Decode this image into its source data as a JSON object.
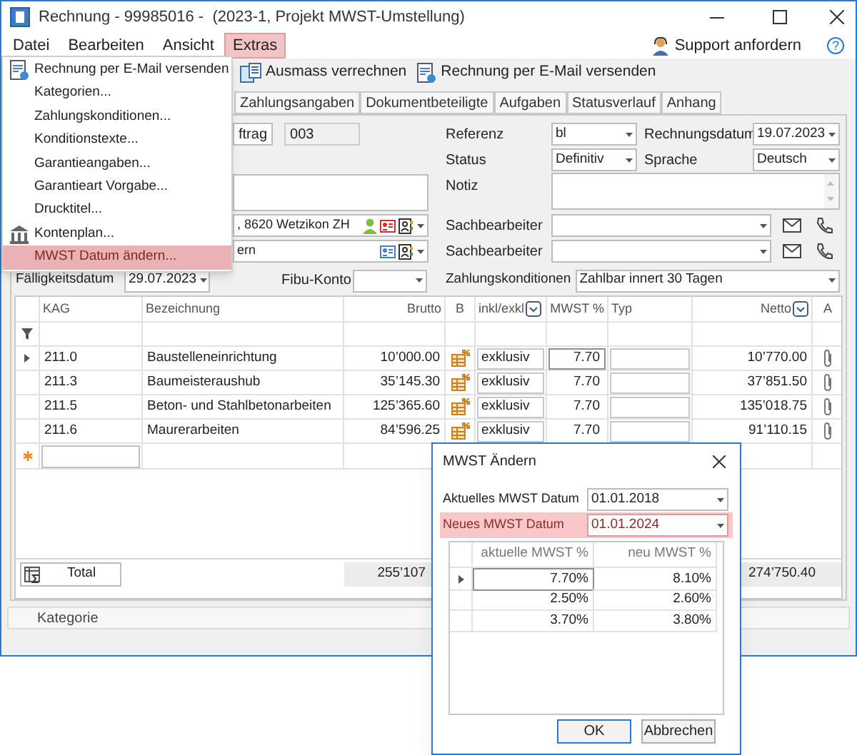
{
  "window": {
    "title": "Rechnung - 99985016 -  (2023-1, Projekt MWST-Umstellung)"
  },
  "menu_bar": {
    "items": [
      {
        "label": "Datei",
        "selected": false
      },
      {
        "label": "Bearbeiten",
        "selected": false
      },
      {
        "label": "Ansicht",
        "selected": false
      },
      {
        "label": "Extras",
        "selected": true
      }
    ],
    "support": "Support anfordern",
    "help": "?"
  },
  "extras_menu": {
    "items": [
      {
        "label": "Rechnung per E-Mail versenden",
        "kind": "email",
        "selected": false
      },
      {
        "label": "Kategorien...",
        "kind": "plain",
        "selected": false
      },
      {
        "label": "Zahlungskonditionen...",
        "kind": "plain",
        "selected": false
      },
      {
        "label": "Konditionstexte...",
        "kind": "plain",
        "selected": false
      },
      {
        "label": "Garantieangaben...",
        "kind": "plain",
        "selected": false
      },
      {
        "label": "Garantieart Vorgabe...",
        "kind": "plain",
        "selected": false
      },
      {
        "label": "Drucktitel...",
        "kind": "plain",
        "selected": false
      },
      {
        "label": "Kontenplan...",
        "kind": "bank",
        "selected": false
      },
      {
        "label": "MWST Datum ändern...",
        "kind": "plain",
        "selected": true
      }
    ]
  },
  "toolbar": [
    {
      "label": "Ausmass verrechnen",
      "kind": "measure"
    },
    {
      "label": "Rechnung per E-Mail versenden",
      "kind": "email"
    }
  ],
  "tabs": [
    {
      "label": "Zahlungsangaben",
      "selected": false
    },
    {
      "label": "Dokumentbeteiligte",
      "selected": false
    },
    {
      "label": "Aufgaben",
      "selected": false
    },
    {
      "label": "Statusverlauf",
      "selected": false
    },
    {
      "label": "Anhang",
      "selected": false
    }
  ],
  "form_left": {
    "order_button": "ftrag",
    "order_number": "003",
    "address": ", 8620 Wetzikon ZH",
    "contact": "ern",
    "due_label": "Fälligkeitsdatum",
    "due_value": "29.07.2023",
    "account_label": "Fibu-Konto"
  },
  "form_right": {
    "reference_label": "Referenz",
    "reference": "bl",
    "invoice_date_label": "Rechnungsdatum",
    "invoice_date": "19.07.2023",
    "status_label": "Status",
    "status": "Definitiv",
    "language_label": "Sprache",
    "language": "Deutsch",
    "note_label": "Notiz",
    "clerks": [
      {
        "label": "Sachbearbeiter"
      },
      {
        "label": "Sachbearbeiter"
      }
    ],
    "terms_label": "Zahlungskonditionen",
    "terms": "Zahlbar innert 30 Tagen"
  },
  "grid": {
    "columns": [
      {
        "label": "KAG",
        "dropdown": false
      },
      {
        "label": "Bezeichnung",
        "dropdown": false
      },
      {
        "label": "Brutto",
        "dropdown": false
      },
      {
        "label": "B",
        "dropdown": false
      },
      {
        "label": "inkl/exkl",
        "dropdown": true
      },
      {
        "label": "MWST %",
        "dropdown": false
      },
      {
        "label": "Typ",
        "dropdown": false
      },
      {
        "label": "Netto",
        "dropdown": true
      },
      {
        "label": "A",
        "dropdown": false
      }
    ],
    "rows": [
      {
        "kag": "211.0",
        "bezeichnung": "Baustelleneinrichtung",
        "brutto": "10’000.00",
        "inkl_exkl": "exklusiv",
        "mwst": "7.70",
        "netto": "10’770.00",
        "selected": true
      },
      {
        "kag": "211.3",
        "bezeichnung": "Baumeisteraushub",
        "brutto": "35’145.30",
        "inkl_exkl": "exklusiv",
        "mwst": "7.70",
        "netto": "37’851.50",
        "selected": false
      },
      {
        "kag": "211.5",
        "bezeichnung": "Beton- und Stahlbetonarbeiten",
        "brutto": "125’365.60",
        "inkl_exkl": "exklusiv",
        "mwst": "7.70",
        "netto": "135’018.75",
        "selected": false
      },
      {
        "kag": "211.6",
        "bezeichnung": "Maurerarbeiten",
        "brutto": "84’596.25",
        "inkl_exkl": "exklusiv",
        "mwst": "7.70",
        "netto": "91’110.15",
        "selected": false
      }
    ],
    "total": {
      "label": "Total",
      "brutto": "255’107",
      "netto": "274’750.40"
    }
  },
  "status_bar": {
    "label": "Kategorie"
  },
  "dialog": {
    "title": "MWST Ändern",
    "fields": [
      {
        "label": "Aktuelles MWST Datum",
        "value": "01.01.2018",
        "highlighted": false
      },
      {
        "label": "Neues MWST Datum",
        "value": "01.01.2024",
        "highlighted": true
      }
    ],
    "columns": [
      "aktuelle MWST %",
      "neu MWST %"
    ],
    "rows": [
      {
        "current": "7.70%",
        "new": "8.10%",
        "selected": true
      },
      {
        "current": "2.50%",
        "new": "2.60%",
        "selected": false
      },
      {
        "current": "3.70%",
        "new": "3.80%",
        "selected": false
      }
    ],
    "buttons": [
      {
        "label": "OK",
        "default": true
      },
      {
        "label": "Abbrechen",
        "default": false
      }
    ]
  }
}
